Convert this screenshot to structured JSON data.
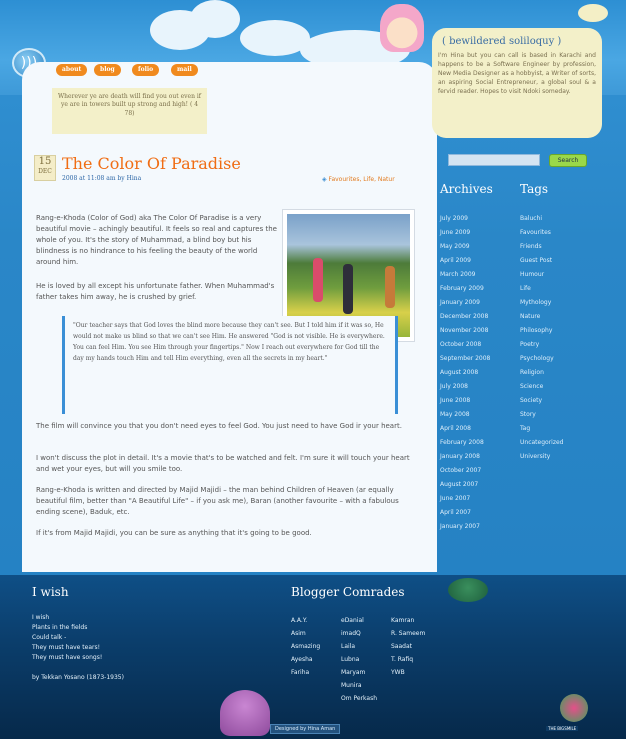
{
  "nav": {
    "items": [
      "about",
      "blog",
      "folio",
      "mail"
    ]
  },
  "header_quote": "Wherever ye are death will find you out even if ye are in towers built up strong and high! ( 4 78)",
  "profile": {
    "title": "( bewildered soliloquy )",
    "text": "I'm Hina but you can call is based in Karachi and happens to be a Software Engineer by profession, New Media Designer as a hobbyist, a Writer of sorts, an aspiring Social Entrepreneur, a global soul & a fervid reader. Hopes to visit Ndoki someday."
  },
  "search": {
    "button": "Search",
    "value": ""
  },
  "post": {
    "day": "15",
    "month": "DEC",
    "title": "The Color Of Paradise",
    "meta": "2008 at 11:08 am by Hina",
    "tags": "Favourites, Life, Natur",
    "p1": "Rang-e-Khoda (Color of God) aka The Color Of Paradise is a very beautiful movie – achingly beautiful. It feels so real and captures the whole of you. It's the story of Muhammad, a blind boy but his blindness is no hindrance to his feeling the beauty of the world around him.",
    "p2": "He is loved by all except his unfortunate father. When Muhammad's father takes him away, he is crushed by grief.",
    "quote": "\"Our teacher says that God loves the blind more because they can't see. But I told him if it was so, He would not make us blind so that we can't see Him. He answered \"God is not visible. He is everywhere. You can feel Him. You see Him through your fingertips.\" Now I reach out everywhere for God till the day my hands touch Him and tell Him everything, even all the secrets in my heart.\"",
    "p3": "The film will convince you that you don't need eyes to feel God. You just need to have God ir your heart.",
    "p4": "I won't discuss the plot in detail. It's a movie that's to be watched and felt. I'm sure it will touch your heart and wet your eyes, but will you smile too.",
    "p5": "Rang-e-Khoda is written and directed by Majid Majidi – the man behind Children of Heaven (ar equally beautiful film, better than \"A Beautiful Life\" – if you ask me), Baran (another favourite – with a fabulous ending scene), Baduk, etc.",
    "p6": "If it's from Majid Majidi, you can be sure as anything that it's going to be good."
  },
  "archives": {
    "title": "Archives",
    "items": [
      "July 2009",
      "June 2009",
      "May 2009",
      "April 2009",
      "March 2009",
      "February 2009",
      "January 2009",
      "December 2008",
      "November 2008",
      "October 2008",
      "September 2008",
      "August 2008",
      "July 2008",
      "June 2008",
      "May 2008",
      "April 2008",
      "February 2008",
      "January 2008",
      "October 2007",
      "August 2007",
      "June 2007",
      "April 2007",
      "January 2007"
    ]
  },
  "tags_widget": {
    "title": "Tags",
    "items": [
      "Baluchi",
      "Favourites",
      "Friends",
      "Guest Post",
      "Humour",
      "Life",
      "Mythology",
      "Nature",
      "Philosophy",
      "Poetry",
      "Psychology",
      "Religion",
      "Science",
      "Society",
      "Story",
      "Tag",
      "Uncategorized",
      "University"
    ]
  },
  "wish": {
    "title": "I wish",
    "lines": [
      "I wish",
      "Plants in the fields",
      "Could talk -",
      "They must have tears!",
      "They must have songs!",
      "",
      "by Tekkan Yosano (1873-1935)"
    ]
  },
  "comrades": {
    "title": "Blogger Comrades",
    "col1": [
      "A.A.Y.",
      "Asim",
      "Asmazing",
      "Ayesha",
      "Fariha"
    ],
    "col2": [
      "eDanial",
      "imadQ",
      "Laila",
      "Lubna",
      "Maryam",
      "Munira",
      "Om Perkash"
    ],
    "col3": [
      "Kamran",
      "R. Sameem",
      "Saadat",
      "T. Rafiq",
      "YWB"
    ]
  },
  "credit": "Designed by Hina Aman",
  "badge": "THE BIGSMILE"
}
